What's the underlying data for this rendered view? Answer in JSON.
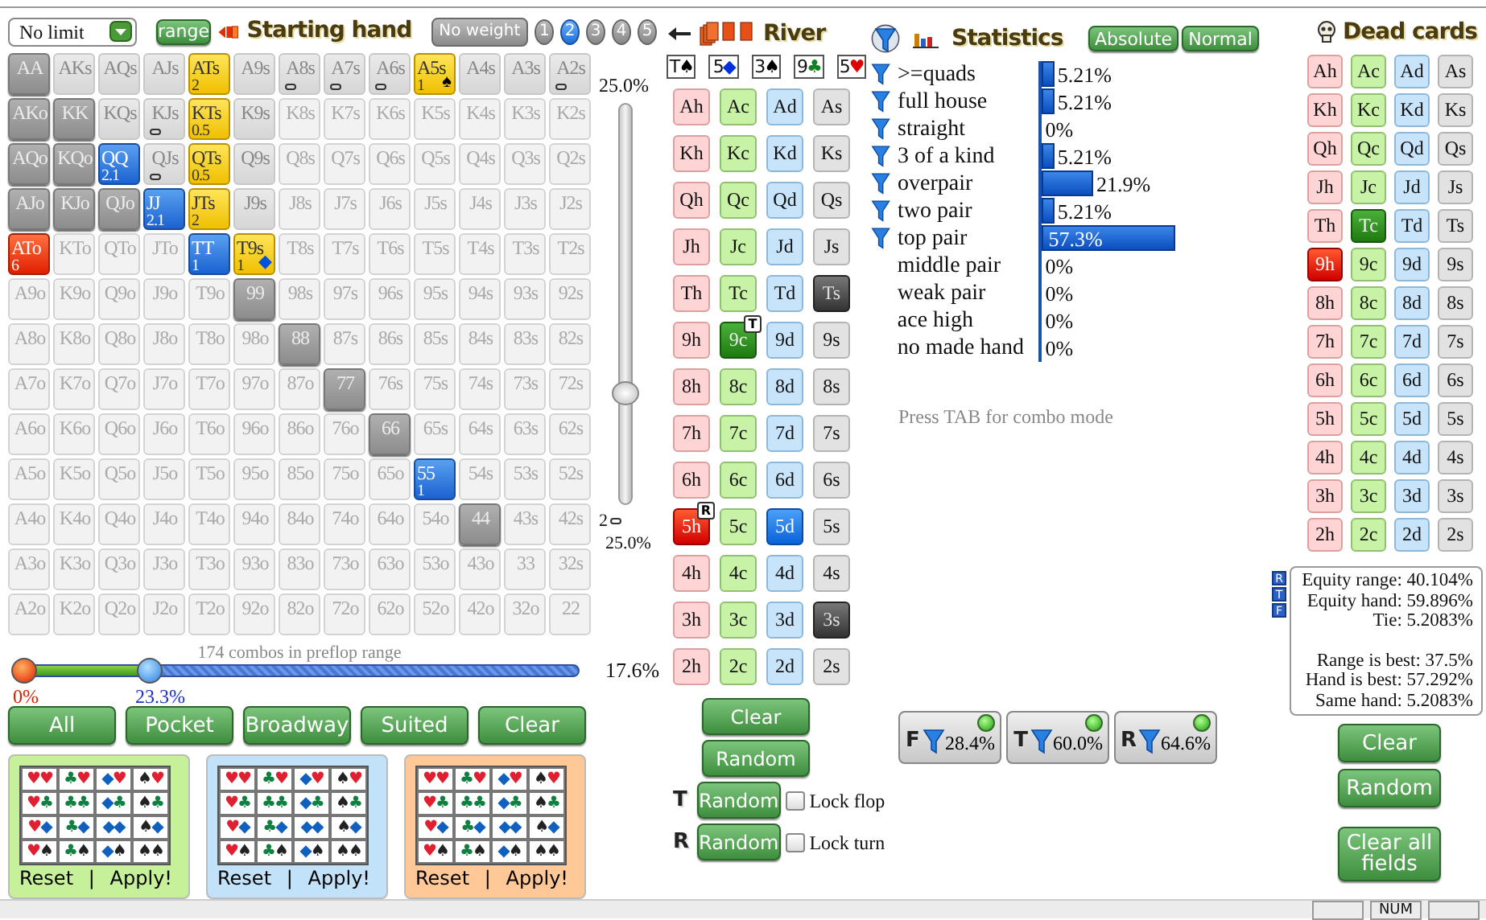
{
  "top_bar": {
    "limit": "No limit",
    "range_button": "range",
    "title": "Starting hand",
    "weight_button": "No weight",
    "weight_levels": [
      {
        "label": "1",
        "selected": false
      },
      {
        "label": "2",
        "selected": true
      },
      {
        "label": "3",
        "selected": false
      },
      {
        "label": "4",
        "selected": false
      },
      {
        "label": "5",
        "selected": false
      }
    ]
  },
  "hand_grid": [
    [
      {
        "hand": "AA",
        "kind": "full",
        "marked": false
      },
      {
        "hand": "AKs",
        "kind": "partial",
        "marked": false
      },
      {
        "hand": "AQs",
        "kind": "partial",
        "marked": false
      },
      {
        "hand": "AJs",
        "kind": "partial",
        "marked": false
      },
      {
        "hand": "ATs",
        "kind": "yellow",
        "weight": "2",
        "marked": false
      },
      {
        "hand": "A9s",
        "kind": "partial",
        "marked": false
      },
      {
        "hand": "A8s",
        "kind": "partial",
        "marked": true
      },
      {
        "hand": "A7s",
        "kind": "partial",
        "marked": true
      },
      {
        "hand": "A6s",
        "kind": "partial",
        "marked": true
      },
      {
        "hand": "A5s",
        "kind": "yellow",
        "weight": "1",
        "suit": "♠",
        "color": "#000000",
        "marked": false
      },
      {
        "hand": "A4s",
        "kind": "partial",
        "marked": false
      },
      {
        "hand": "A3s",
        "kind": "partial",
        "marked": false
      },
      {
        "hand": "A2s",
        "kind": "partial",
        "marked": true
      }
    ],
    [
      {
        "hand": "AKo",
        "kind": "full",
        "marked": false
      },
      {
        "hand": "KK",
        "kind": "full",
        "marked": false
      },
      {
        "hand": "KQs",
        "kind": "partial",
        "marked": false
      },
      {
        "hand": "KJs",
        "kind": "partial",
        "marked": true
      },
      {
        "hand": "KTs",
        "kind": "yellow",
        "weight": "0.5",
        "marked": false
      },
      {
        "hand": "K9s",
        "kind": "partial",
        "marked": false
      },
      {
        "hand": "K8s",
        "kind": "none",
        "marked": false
      },
      {
        "hand": "K7s",
        "kind": "none",
        "marked": false
      },
      {
        "hand": "K6s",
        "kind": "none",
        "marked": false
      },
      {
        "hand": "K5s",
        "kind": "none",
        "marked": false
      },
      {
        "hand": "K4s",
        "kind": "none",
        "marked": false
      },
      {
        "hand": "K3s",
        "kind": "none",
        "marked": false
      },
      {
        "hand": "K2s",
        "kind": "none",
        "marked": false
      }
    ],
    [
      {
        "hand": "AQo",
        "kind": "full",
        "marked": false
      },
      {
        "hand": "KQo",
        "kind": "full",
        "marked": false
      },
      {
        "hand": "QQ",
        "kind": "blue",
        "weight": "2.1",
        "marked": false
      },
      {
        "hand": "QJs",
        "kind": "partial",
        "marked": true
      },
      {
        "hand": "QTs",
        "kind": "yellow",
        "weight": "0.5",
        "marked": false
      },
      {
        "hand": "Q9s",
        "kind": "partial",
        "marked": false
      },
      {
        "hand": "Q8s",
        "kind": "none",
        "marked": false
      },
      {
        "hand": "Q7s",
        "kind": "none",
        "marked": false
      },
      {
        "hand": "Q6s",
        "kind": "none",
        "marked": false
      },
      {
        "hand": "Q5s",
        "kind": "none",
        "marked": false
      },
      {
        "hand": "Q4s",
        "kind": "none",
        "marked": false
      },
      {
        "hand": "Q3s",
        "kind": "none",
        "marked": false
      },
      {
        "hand": "Q2s",
        "kind": "none",
        "marked": false
      }
    ],
    [
      {
        "hand": "AJo",
        "kind": "full",
        "marked": false
      },
      {
        "hand": "KJo",
        "kind": "full",
        "marked": false
      },
      {
        "hand": "QJo",
        "kind": "full",
        "marked": false
      },
      {
        "hand": "JJ",
        "kind": "blue",
        "weight": "2.1",
        "marked": false
      },
      {
        "hand": "JTs",
        "kind": "yellow",
        "weight": "2",
        "marked": false
      },
      {
        "hand": "J9s",
        "kind": "partial",
        "marked": false
      },
      {
        "hand": "J8s",
        "kind": "none",
        "marked": false
      },
      {
        "hand": "J7s",
        "kind": "none",
        "marked": false
      },
      {
        "hand": "J6s",
        "kind": "none",
        "marked": false
      },
      {
        "hand": "J5s",
        "kind": "none",
        "marked": false
      },
      {
        "hand": "J4s",
        "kind": "none",
        "marked": false
      },
      {
        "hand": "J3s",
        "kind": "none",
        "marked": false
      },
      {
        "hand": "J2s",
        "kind": "none",
        "marked": false
      }
    ],
    [
      {
        "hand": "ATo",
        "kind": "red",
        "weight": "6",
        "marked": false
      },
      {
        "hand": "KTo",
        "kind": "none",
        "marked": false
      },
      {
        "hand": "QTo",
        "kind": "none",
        "marked": false
      },
      {
        "hand": "JTo",
        "kind": "none",
        "marked": false
      },
      {
        "hand": "TT",
        "kind": "blue",
        "weight": "1",
        "marked": false
      },
      {
        "hand": "T9s",
        "kind": "yellow",
        "weight": "1",
        "suit": "◆",
        "color": "#0050e0",
        "marked": false
      },
      {
        "hand": "T8s",
        "kind": "none",
        "marked": false
      },
      {
        "hand": "T7s",
        "kind": "none",
        "marked": false
      },
      {
        "hand": "T6s",
        "kind": "none",
        "marked": false
      },
      {
        "hand": "T5s",
        "kind": "none",
        "marked": false
      },
      {
        "hand": "T4s",
        "kind": "none",
        "marked": false
      },
      {
        "hand": "T3s",
        "kind": "none",
        "marked": false
      },
      {
        "hand": "T2s",
        "kind": "none",
        "marked": false
      }
    ],
    [
      {
        "hand": "A9o",
        "kind": "none",
        "marked": false
      },
      {
        "hand": "K9o",
        "kind": "none",
        "marked": false
      },
      {
        "hand": "Q9o",
        "kind": "none",
        "marked": false
      },
      {
        "hand": "J9o",
        "kind": "none",
        "marked": false
      },
      {
        "hand": "T9o",
        "kind": "none",
        "marked": false
      },
      {
        "hand": "99",
        "kind": "full",
        "marked": false
      },
      {
        "hand": "98s",
        "kind": "none",
        "marked": false
      },
      {
        "hand": "97s",
        "kind": "none",
        "marked": false
      },
      {
        "hand": "96s",
        "kind": "none",
        "marked": false
      },
      {
        "hand": "95s",
        "kind": "none",
        "marked": false
      },
      {
        "hand": "94s",
        "kind": "none",
        "marked": false
      },
      {
        "hand": "93s",
        "kind": "none",
        "marked": false
      },
      {
        "hand": "92s",
        "kind": "none",
        "marked": false
      }
    ],
    [
      {
        "hand": "A8o",
        "kind": "none",
        "marked": false
      },
      {
        "hand": "K8o",
        "kind": "none",
        "marked": false
      },
      {
        "hand": "Q8o",
        "kind": "none",
        "marked": false
      },
      {
        "hand": "J8o",
        "kind": "none",
        "marked": false
      },
      {
        "hand": "T8o",
        "kind": "none",
        "marked": false
      },
      {
        "hand": "98o",
        "kind": "none",
        "marked": false
      },
      {
        "hand": "88",
        "kind": "full",
        "marked": false
      },
      {
        "hand": "87s",
        "kind": "none",
        "marked": false
      },
      {
        "hand": "86s",
        "kind": "none",
        "marked": false
      },
      {
        "hand": "85s",
        "kind": "none",
        "marked": false
      },
      {
        "hand": "84s",
        "kind": "none",
        "marked": false
      },
      {
        "hand": "83s",
        "kind": "none",
        "marked": false
      },
      {
        "hand": "82s",
        "kind": "none",
        "marked": false
      }
    ],
    [
      {
        "hand": "A7o",
        "kind": "none",
        "marked": false
      },
      {
        "hand": "K7o",
        "kind": "none",
        "marked": false
      },
      {
        "hand": "Q7o",
        "kind": "none",
        "marked": false
      },
      {
        "hand": "J7o",
        "kind": "none",
        "marked": false
      },
      {
        "hand": "T7o",
        "kind": "none",
        "marked": false
      },
      {
        "hand": "97o",
        "kind": "none",
        "marked": false
      },
      {
        "hand": "87o",
        "kind": "none",
        "marked": false
      },
      {
        "hand": "77",
        "kind": "full",
        "marked": false
      },
      {
        "hand": "76s",
        "kind": "none",
        "marked": false
      },
      {
        "hand": "75s",
        "kind": "none",
        "marked": false
      },
      {
        "hand": "74s",
        "kind": "none",
        "marked": false
      },
      {
        "hand": "73s",
        "kind": "none",
        "marked": false
      },
      {
        "hand": "72s",
        "kind": "none",
        "marked": false
      }
    ],
    [
      {
        "hand": "A6o",
        "kind": "none",
        "marked": false
      },
      {
        "hand": "K6o",
        "kind": "none",
        "marked": false
      },
      {
        "hand": "Q6o",
        "kind": "none",
        "marked": false
      },
      {
        "hand": "J6o",
        "kind": "none",
        "marked": false
      },
      {
        "hand": "T6o",
        "kind": "none",
        "marked": false
      },
      {
        "hand": "96o",
        "kind": "none",
        "marked": false
      },
      {
        "hand": "86o",
        "kind": "none",
        "marked": false
      },
      {
        "hand": "76o",
        "kind": "none",
        "marked": false
      },
      {
        "hand": "66",
        "kind": "full",
        "marked": false
      },
      {
        "hand": "65s",
        "kind": "none",
        "marked": false
      },
      {
        "hand": "64s",
        "kind": "none",
        "marked": false
      },
      {
        "hand": "63s",
        "kind": "none",
        "marked": false
      },
      {
        "hand": "62s",
        "kind": "none",
        "marked": false
      }
    ],
    [
      {
        "hand": "A5o",
        "kind": "none",
        "marked": false
      },
      {
        "hand": "K5o",
        "kind": "none",
        "marked": false
      },
      {
        "hand": "Q5o",
        "kind": "none",
        "marked": false
      },
      {
        "hand": "J5o",
        "kind": "none",
        "marked": false
      },
      {
        "hand": "T5o",
        "kind": "none",
        "marked": false
      },
      {
        "hand": "95o",
        "kind": "none",
        "marked": false
      },
      {
        "hand": "85o",
        "kind": "none",
        "marked": false
      },
      {
        "hand": "75o",
        "kind": "none",
        "marked": false
      },
      {
        "hand": "65o",
        "kind": "none",
        "marked": false
      },
      {
        "hand": "55",
        "kind": "blue",
        "weight": "1",
        "marked": false
      },
      {
        "hand": "54s",
        "kind": "none",
        "marked": false
      },
      {
        "hand": "53s",
        "kind": "none",
        "marked": false
      },
      {
        "hand": "52s",
        "kind": "none",
        "marked": false
      }
    ],
    [
      {
        "hand": "A4o",
        "kind": "none",
        "marked": false
      },
      {
        "hand": "K4o",
        "kind": "none",
        "marked": false
      },
      {
        "hand": "Q4o",
        "kind": "none",
        "marked": false
      },
      {
        "hand": "J4o",
        "kind": "none",
        "marked": false
      },
      {
        "hand": "T4o",
        "kind": "none",
        "marked": false
      },
      {
        "hand": "94o",
        "kind": "none",
        "marked": false
      },
      {
        "hand": "84o",
        "kind": "none",
        "marked": false
      },
      {
        "hand": "74o",
        "kind": "none",
        "marked": false
      },
      {
        "hand": "64o",
        "kind": "none",
        "marked": false
      },
      {
        "hand": "54o",
        "kind": "none",
        "marked": false
      },
      {
        "hand": "44",
        "kind": "full",
        "marked": false
      },
      {
        "hand": "43s",
        "kind": "none",
        "marked": false
      },
      {
        "hand": "42s",
        "kind": "none",
        "marked": false
      }
    ],
    [
      {
        "hand": "A3o",
        "kind": "none",
        "marked": false
      },
      {
        "hand": "K3o",
        "kind": "none",
        "marked": false
      },
      {
        "hand": "Q3o",
        "kind": "none",
        "marked": false
      },
      {
        "hand": "J3o",
        "kind": "none",
        "marked": false
      },
      {
        "hand": "T3o",
        "kind": "none",
        "marked": false
      },
      {
        "hand": "93o",
        "kind": "none",
        "marked": false
      },
      {
        "hand": "83o",
        "kind": "none",
        "marked": false
      },
      {
        "hand": "73o",
        "kind": "none",
        "marked": false
      },
      {
        "hand": "63o",
        "kind": "none",
        "marked": false
      },
      {
        "hand": "53o",
        "kind": "none",
        "marked": false
      },
      {
        "hand": "43o",
        "kind": "none",
        "marked": false
      },
      {
        "hand": "33",
        "kind": "none",
        "marked": false
      },
      {
        "hand": "32s",
        "kind": "none",
        "marked": false
      }
    ],
    [
      {
        "hand": "A2o",
        "kind": "none",
        "marked": false
      },
      {
        "hand": "K2o",
        "kind": "none",
        "marked": false
      },
      {
        "hand": "Q2o",
        "kind": "none",
        "marked": false
      },
      {
        "hand": "J2o",
        "kind": "none",
        "marked": false
      },
      {
        "hand": "T2o",
        "kind": "none",
        "marked": false
      },
      {
        "hand": "92o",
        "kind": "none",
        "marked": false
      },
      {
        "hand": "82o",
        "kind": "none",
        "marked": false
      },
      {
        "hand": "72o",
        "kind": "none",
        "marked": false
      },
      {
        "hand": "62o",
        "kind": "none",
        "marked": false
      },
      {
        "hand": "52o",
        "kind": "none",
        "marked": false
      },
      {
        "hand": "42o",
        "kind": "none",
        "marked": false
      },
      {
        "hand": "32o",
        "kind": "none",
        "marked": false
      },
      {
        "hand": "22",
        "kind": "none",
        "marked": false
      }
    ]
  ],
  "weight_slider": {
    "top_label": "25.0%",
    "level": 0.28,
    "bottom_value": "2",
    "bottom_label": "25.0%"
  },
  "range_slider": {
    "caption": "174 combos in preflop range",
    "thumbs": [
      {
        "level": 0,
        "label": "0%"
      },
      {
        "level": 0.226,
        "label": "23.3%"
      }
    ],
    "reading": "17.6%"
  },
  "range_buttons": [
    "All",
    "Pocket",
    "Broadway",
    "Suited",
    "Clear"
  ],
  "suit_panels": [
    {
      "color": "#c6f09a",
      "suits": [
        {
          "symbol": "♥",
          "color": "#e02030"
        },
        {
          "symbol": "♣",
          "color": "#108040"
        },
        {
          "symbol": "◆",
          "color": "#1060c0"
        },
        {
          "symbol": "♠",
          "color": "#222222"
        }
      ],
      "reset": "Reset",
      "separator": "|",
      "apply": "Apply!"
    },
    {
      "color": "#c2e2fa",
      "suits": [
        {
          "symbol": "♥",
          "color": "#e02030"
        },
        {
          "symbol": "♣",
          "color": "#108040"
        },
        {
          "symbol": "◆",
          "color": "#1060c0"
        },
        {
          "symbol": "♠",
          "color": "#222222"
        }
      ],
      "reset": "Reset",
      "separator": "|",
      "apply": "Apply!"
    },
    {
      "color": "#ffc896",
      "suits": [
        {
          "symbol": "♥",
          "color": "#e02030"
        },
        {
          "symbol": "♣",
          "color": "#108040"
        },
        {
          "symbol": "◆",
          "color": "#1060c0"
        },
        {
          "symbol": "♠",
          "color": "#222222"
        }
      ],
      "reset": "Reset",
      "separator": "|",
      "apply": "Apply!"
    }
  ],
  "board": {
    "title": "River",
    "cards": [
      {
        "rank": "T",
        "suit": "♠",
        "color": "#000000"
      },
      {
        "rank": "5",
        "suit": "◆",
        "color": "#0030e0"
      },
      {
        "rank": "3",
        "suit": "♠",
        "color": "#000000"
      },
      {
        "rank": "9",
        "suit": "♣",
        "color": "#108020"
      },
      {
        "rank": "5",
        "suit": "♥",
        "color": "#e00000"
      }
    ]
  },
  "cards": [
    [
      {
        "card": "Ah",
        "kind": "free"
      },
      {
        "card": "Ac",
        "kind": "free"
      },
      {
        "card": "Ad",
        "kind": "free"
      },
      {
        "card": "As",
        "kind": "free"
      }
    ],
    [
      {
        "card": "Kh",
        "kind": "free"
      },
      {
        "card": "Kc",
        "kind": "free"
      },
      {
        "card": "Kd",
        "kind": "free"
      },
      {
        "card": "Ks",
        "kind": "free"
      }
    ],
    [
      {
        "card": "Qh",
        "kind": "free"
      },
      {
        "card": "Qc",
        "kind": "free"
      },
      {
        "card": "Qd",
        "kind": "free"
      },
      {
        "card": "Qs",
        "kind": "free"
      }
    ],
    [
      {
        "card": "Jh",
        "kind": "free"
      },
      {
        "card": "Jc",
        "kind": "free"
      },
      {
        "card": "Jd",
        "kind": "free"
      },
      {
        "card": "Js",
        "kind": "free"
      }
    ],
    [
      {
        "card": "Th",
        "kind": "free"
      },
      {
        "card": "Tc",
        "kind": "free"
      },
      {
        "card": "Td",
        "kind": "free"
      },
      {
        "card": "Ts",
        "kind": "dark"
      }
    ],
    [
      {
        "card": "9h",
        "kind": "free"
      },
      {
        "card": "9c",
        "kind": "green",
        "badge": "T"
      },
      {
        "card": "9d",
        "kind": "free"
      },
      {
        "card": "9s",
        "kind": "free"
      }
    ],
    [
      {
        "card": "8h",
        "kind": "free"
      },
      {
        "card": "8c",
        "kind": "free"
      },
      {
        "card": "8d",
        "kind": "free"
      },
      {
        "card": "8s",
        "kind": "free"
      }
    ],
    [
      {
        "card": "7h",
        "kind": "free"
      },
      {
        "card": "7c",
        "kind": "free"
      },
      {
        "card": "7d",
        "kind": "free"
      },
      {
        "card": "7s",
        "kind": "free"
      }
    ],
    [
      {
        "card": "6h",
        "kind": "free"
      },
      {
        "card": "6c",
        "kind": "free"
      },
      {
        "card": "6d",
        "kind": "free"
      },
      {
        "card": "6s",
        "kind": "free"
      }
    ],
    [
      {
        "card": "5h",
        "kind": "red",
        "badge": "R"
      },
      {
        "card": "5c",
        "kind": "free"
      },
      {
        "card": "5d",
        "kind": "blue"
      },
      {
        "card": "5s",
        "kind": "free"
      }
    ],
    [
      {
        "card": "4h",
        "kind": "free"
      },
      {
        "card": "4c",
        "kind": "free"
      },
      {
        "card": "4d",
        "kind": "free"
      },
      {
        "card": "4s",
        "kind": "free"
      }
    ],
    [
      {
        "card": "3h",
        "kind": "free"
      },
      {
        "card": "3c",
        "kind": "free"
      },
      {
        "card": "3d",
        "kind": "free"
      },
      {
        "card": "3s",
        "kind": "dark"
      }
    ],
    [
      {
        "card": "2h",
        "kind": "free"
      },
      {
        "card": "2c",
        "kind": "free"
      },
      {
        "card": "2d",
        "kind": "free"
      },
      {
        "card": "2s",
        "kind": "free"
      }
    ]
  ],
  "board_buttons": {
    "clear": "Clear",
    "random": "Random",
    "turn_marker": "T",
    "turn_random": "Random",
    "lock_flop": {
      "label": "Lock flop",
      "checked": false
    },
    "river_marker": "R",
    "river_random": "Random",
    "lock_turn": {
      "label": "Lock turn",
      "checked": false
    }
  },
  "statistics": {
    "title": "Statistics",
    "buttons": [
      "Absolute",
      "Normal"
    ],
    "rows": [
      {
        "label": ">=quads",
        "filter": true,
        "level": 0.0521,
        "value": "5.21%"
      },
      {
        "label": "full house",
        "filter": true,
        "level": 0.0521,
        "value": "5.21%"
      },
      {
        "label": "straight",
        "filter": true,
        "value": "0%"
      },
      {
        "label": "3 of a kind",
        "filter": true,
        "level": 0.0521,
        "value": "5.21%"
      },
      {
        "label": "overpair",
        "filter": true,
        "level": 0.219,
        "value": "21.9%"
      },
      {
        "label": "two pair",
        "filter": true,
        "level": 0.0521,
        "value": "5.21%"
      },
      {
        "label": "top pair",
        "filter": true,
        "level": 0.573,
        "value": "57.3%"
      },
      {
        "label": "middle pair",
        "filter": false,
        "value": "0%"
      },
      {
        "label": "weak pair",
        "filter": false,
        "value": "0%"
      },
      {
        "label": "ace high",
        "filter": false,
        "value": "0%"
      },
      {
        "label": "no made hand",
        "filter": false,
        "value": "0%"
      }
    ],
    "hint": "Press TAB for combo mode",
    "filters": [
      {
        "letter": "F",
        "value": "28.4%",
        "on": true
      },
      {
        "letter": "T",
        "value": "60.0%",
        "on": true
      },
      {
        "letter": "R",
        "value": "64.6%",
        "on": true
      }
    ]
  },
  "dead_cards": {
    "title": "Dead cards",
    "rows": [
      [
        {
          "card": "Ah",
          "kind": "free"
        },
        {
          "card": "Ac",
          "kind": "free"
        },
        {
          "card": "Ad",
          "kind": "free"
        },
        {
          "card": "As",
          "kind": "free"
        }
      ],
      [
        {
          "card": "Kh",
          "kind": "free"
        },
        {
          "card": "Kc",
          "kind": "free"
        },
        {
          "card": "Kd",
          "kind": "free"
        },
        {
          "card": "Ks",
          "kind": "free"
        }
      ],
      [
        {
          "card": "Qh",
          "kind": "free"
        },
        {
          "card": "Qc",
          "kind": "free"
        },
        {
          "card": "Qd",
          "kind": "free"
        },
        {
          "card": "Qs",
          "kind": "free"
        }
      ],
      [
        {
          "card": "Jh",
          "kind": "free"
        },
        {
          "card": "Jc",
          "kind": "free"
        },
        {
          "card": "Jd",
          "kind": "free"
        },
        {
          "card": "Js",
          "kind": "free"
        }
      ],
      [
        {
          "card": "Th",
          "kind": "free"
        },
        {
          "card": "Tc",
          "kind": "green"
        },
        {
          "card": "Td",
          "kind": "free"
        },
        {
          "card": "Ts",
          "kind": "free"
        }
      ],
      [
        {
          "card": "9h",
          "kind": "red"
        },
        {
          "card": "9c",
          "kind": "free"
        },
        {
          "card": "9d",
          "kind": "free"
        },
        {
          "card": "9s",
          "kind": "free"
        }
      ],
      [
        {
          "card": "8h",
          "kind": "free"
        },
        {
          "card": "8c",
          "kind": "free"
        },
        {
          "card": "8d",
          "kind": "free"
        },
        {
          "card": "8s",
          "kind": "free"
        }
      ],
      [
        {
          "card": "7h",
          "kind": "free"
        },
        {
          "card": "7c",
          "kind": "free"
        },
        {
          "card": "7d",
          "kind": "free"
        },
        {
          "card": "7s",
          "kind": "free"
        }
      ],
      [
        {
          "card": "6h",
          "kind": "free"
        },
        {
          "card": "6c",
          "kind": "free"
        },
        {
          "card": "6d",
          "kind": "free"
        },
        {
          "card": "6s",
          "kind": "free"
        }
      ],
      [
        {
          "card": "5h",
          "kind": "free"
        },
        {
          "card": "5c",
          "kind": "free"
        },
        {
          "card": "5d",
          "kind": "free"
        },
        {
          "card": "5s",
          "kind": "free"
        }
      ],
      [
        {
          "card": "4h",
          "kind": "free"
        },
        {
          "card": "4c",
          "kind": "free"
        },
        {
          "card": "4d",
          "kind": "free"
        },
        {
          "card": "4s",
          "kind": "free"
        }
      ],
      [
        {
          "card": "3h",
          "kind": "free"
        },
        {
          "card": "3c",
          "kind": "free"
        },
        {
          "card": "3d",
          "kind": "free"
        },
        {
          "card": "3s",
          "kind": "free"
        }
      ],
      [
        {
          "card": "2h",
          "kind": "free"
        },
        {
          "card": "2c",
          "kind": "free"
        },
        {
          "card": "2d",
          "kind": "free"
        },
        {
          "card": "2s",
          "kind": "free"
        }
      ]
    ]
  },
  "equity": {
    "markers": [
      "R",
      "T",
      "F"
    ],
    "lines": [
      "Equity range: 40.104%",
      "Equity hand: 59.896%",
      "Tie: 5.2083%"
    ],
    "best_lines": [
      "Range is best: 37.5%",
      "Hand is best: 57.292%",
      "Same hand: 5.2083%"
    ]
  },
  "dead_buttons": [
    "Clear",
    "Random",
    "Clear all fields"
  ],
  "status_bar": {
    "indicators": [
      "NUM"
    ]
  }
}
